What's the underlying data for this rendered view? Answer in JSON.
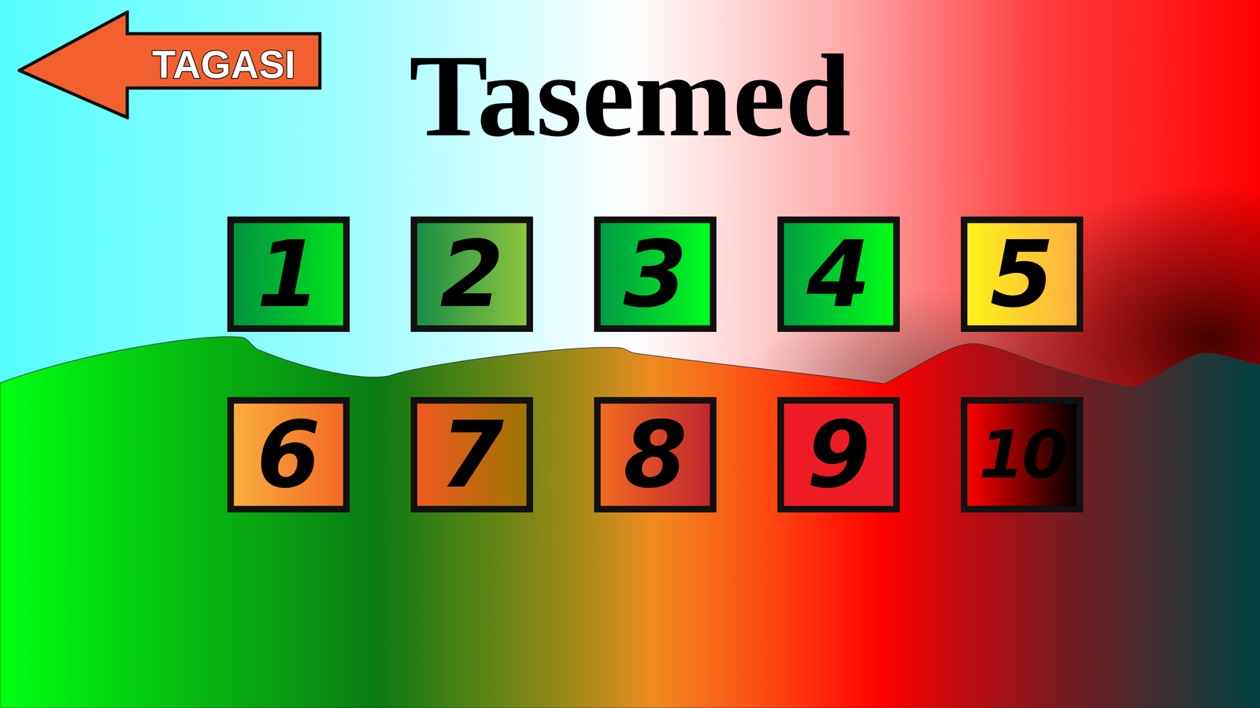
{
  "back_button": {
    "label": "TAGASI"
  },
  "title": "Tasemed",
  "levels": [
    {
      "label": "1",
      "color": "#00913f",
      "color_end": "#00e51c"
    },
    {
      "label": "2",
      "color": "#1a8d45",
      "color_end": "#8dc63f"
    },
    {
      "label": "3",
      "color": "#009a44",
      "color_end": "#00ff1e"
    },
    {
      "label": "4",
      "color": "#00a13f",
      "color_end": "#00ff16"
    },
    {
      "label": "5",
      "color": "#fff21a",
      "color_end": "#fbb040"
    },
    {
      "label": "6",
      "color": "#fbad3f",
      "color_end": "#f26a24"
    },
    {
      "label": "7",
      "color": "#f05a22",
      "color_end": "#9e7400"
    },
    {
      "label": "8",
      "color": "#f26a22",
      "color_end": "#c1272d"
    },
    {
      "label": "9",
      "color": "#ed1c24",
      "color_end": "#ed1c24"
    },
    {
      "label": "10",
      "color": "#ff0000",
      "color_end": "#000000"
    }
  ]
}
